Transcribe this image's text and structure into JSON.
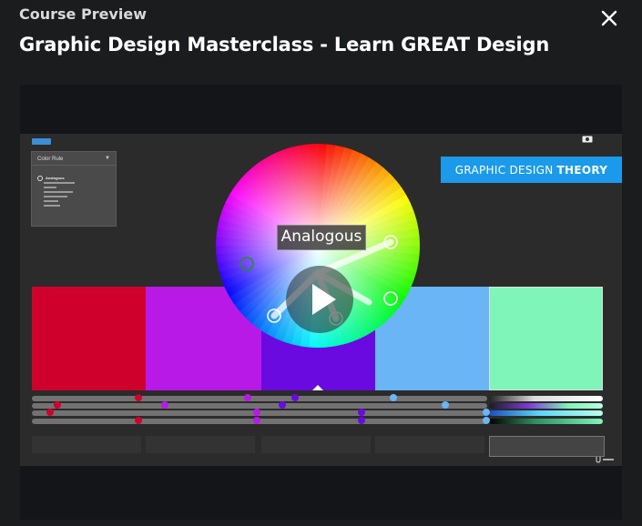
{
  "header": {
    "subtitle": "Course Preview",
    "title": "Graphic Design Masterclass - Learn GREAT Design"
  },
  "video": {
    "color_rule_panel": {
      "title": "Color Rule",
      "selected": "Analogous"
    },
    "banner": {
      "text_light": "GRAPHIC DESIGN",
      "text_bold": "THEORY"
    },
    "wheel_label": "Analogous",
    "swatches": [
      "#d0002c",
      "#b819e6",
      "#6a0ae0",
      "#69b5f5",
      "#7ff5b9"
    ],
    "colors": {
      "banner": "#1b9aea",
      "stage": "#2b2b2b"
    }
  }
}
